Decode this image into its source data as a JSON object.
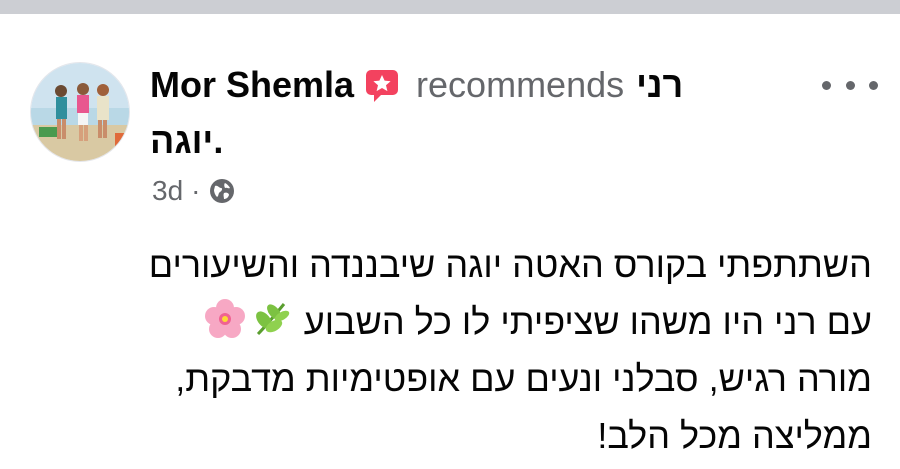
{
  "post": {
    "author": "Mor Shemla",
    "action": "recommends",
    "page_name": "רני",
    "page_name_cont": "יוגה.",
    "time": "3d",
    "separator": "·",
    "audience_icon": "globe-icon",
    "more_icon": "more-horizontal-icon",
    "badge_icon": "recommendation-star-icon",
    "body_lines": [
      "השתתפתי בקורס האטה יוגה שיבננדה והשיעורים",
      "עם רני היו משהו שציפיתי לו כל השבוע",
      "מורה רגיש, סבלני ונעים עם אופטימיות מדבקת,",
      "ממליצה מכל הלב!"
    ],
    "emojis": [
      "herb-icon",
      "cherry-blossom-icon"
    ]
  },
  "colors": {
    "badge": "#f3425f",
    "secondary_text": "#65676b",
    "top_strip": "#ccced3"
  }
}
